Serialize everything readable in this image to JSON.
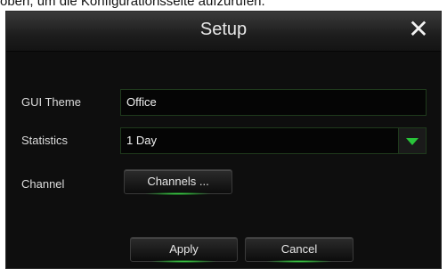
{
  "caption": "oben, um die Konfigurationsseite aufzurufen.",
  "dialog": {
    "title": "Setup",
    "close_glyph": "✕"
  },
  "form": {
    "gui_theme_label": "GUI Theme",
    "gui_theme_value": "Office",
    "statistics_label": "Statistics",
    "statistics_value": "1 Day",
    "channel_label": "Channel",
    "channels_button": "Channels ..."
  },
  "footer": {
    "apply_label": "Apply",
    "cancel_label": "Cancel"
  },
  "colors": {
    "accent_green": "#29c43a",
    "dialog_bg": "#0e0e0e"
  }
}
